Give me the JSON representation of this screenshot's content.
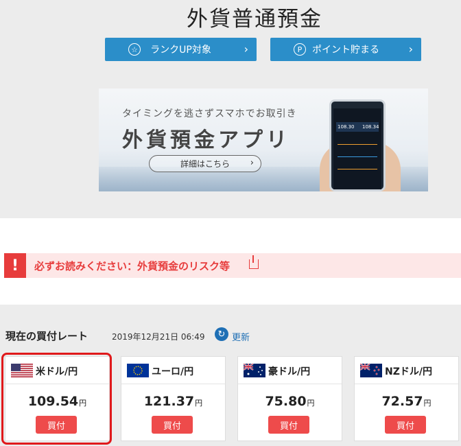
{
  "page": {
    "title": "外貨普通預金"
  },
  "buttons": {
    "rank_up": "ランクUP対象",
    "points": "ポイント貯まる",
    "chevron": "›"
  },
  "banner": {
    "subtitle": "タイミングを逃さずスマホでお取引き",
    "title": "外貨預金アプリ",
    "details_label": "詳細はこちら",
    "phone_values": [
      "108.30",
      "108.34"
    ]
  },
  "notice": {
    "text": "必ずお読みください：外貨預金のリスク等"
  },
  "rates": {
    "heading": "現在の買付レート",
    "datetime": "2019年12月21日 06:49",
    "refresh_label": "更新",
    "unit": "円",
    "buy_label": "買付",
    "items": [
      {
        "name": "米ドル/円",
        "value": "109.54",
        "flag": "us-flag-icon"
      },
      {
        "name": "ユーロ/円",
        "value": "121.37",
        "flag": "eu-flag-icon"
      },
      {
        "name": "豪ドル/円",
        "value": "75.80",
        "flag": "au-flag-icon"
      },
      {
        "name": "NZドル/円",
        "value": "72.57",
        "flag": "nz-flag-icon"
      }
    ]
  },
  "colors": {
    "accent_blue": "#2b8ec9",
    "alert_red": "#e73c3c",
    "buy_red": "#ee4b4b"
  }
}
